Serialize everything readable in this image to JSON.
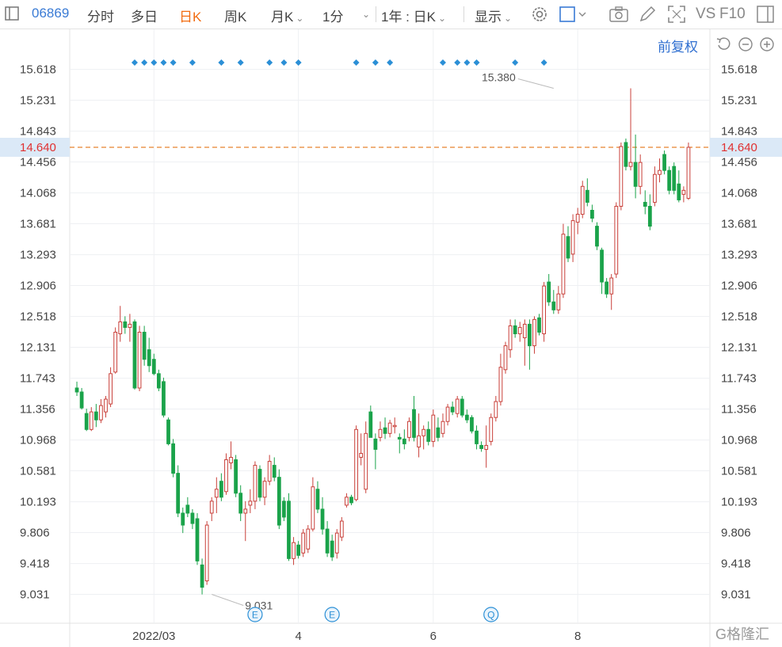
{
  "toolbar": {
    "code": "06869",
    "items": [
      "分时",
      "多日",
      "日K",
      "周K",
      "月K",
      "1分",
      "1年 : 日K",
      "显示"
    ],
    "active": "日K",
    "right_text": [
      "VS",
      "F10"
    ]
  },
  "fuquan_label": "前复权",
  "colors": {
    "up": "#c9403a",
    "down": "#1aa34a",
    "current": "#e6822e",
    "event": "#2b8fd6",
    "accent": "#f26c11",
    "link": "#2f6fd0"
  },
  "icons": [
    "settings-icon",
    "display-box-icon",
    "camera-icon",
    "pen-icon",
    "fullscreen-icon",
    "window-icon",
    "reset-icon",
    "zoom-out-icon",
    "zoom-in-icon"
  ],
  "chart_data": {
    "type": "candlestick",
    "y_ticks": [
      "15.618",
      "15.231",
      "14.843",
      "14.456",
      "14.068",
      "13.681",
      "13.293",
      "12.906",
      "12.518",
      "12.131",
      "11.743",
      "11.356",
      "10.968",
      "10.581",
      "10.193",
      "9.806",
      "9.418",
      "9.031"
    ],
    "ylim": [
      8.85,
      15.8
    ],
    "x_ticks": [
      {
        "label": "2022/03",
        "index": 16
      },
      {
        "label": "4",
        "index": 46
      },
      {
        "label": "6",
        "index": 74
      },
      {
        "label": "8",
        "index": 104
      }
    ],
    "current_price": "14.640",
    "high_label": {
      "value": "15.380",
      "index": 99
    },
    "low_label": {
      "value": "9.031",
      "index": 28
    },
    "event_markers": [
      {
        "label": "E",
        "index": 37
      },
      {
        "label": "E",
        "index": 53
      },
      {
        "label": "Q",
        "index": 86
      }
    ],
    "top_marker_indices": [
      12,
      14,
      16,
      18,
      20,
      24,
      30,
      34,
      40,
      43,
      46,
      58,
      62,
      65,
      76,
      79,
      81,
      83,
      91,
      97
    ],
    "candles": [
      {
        "o": 11.62,
        "h": 11.7,
        "l": 11.52,
        "c": 11.57
      },
      {
        "o": 11.57,
        "h": 11.62,
        "l": 11.35,
        "c": 11.37
      },
      {
        "o": 11.3,
        "h": 11.36,
        "l": 11.08,
        "c": 11.1
      },
      {
        "o": 11.1,
        "h": 11.38,
        "l": 11.08,
        "c": 11.32
      },
      {
        "o": 11.32,
        "h": 11.42,
        "l": 11.13,
        "c": 11.22
      },
      {
        "o": 11.22,
        "h": 11.48,
        "l": 11.18,
        "c": 11.4
      },
      {
        "o": 11.32,
        "h": 11.52,
        "l": 11.25,
        "c": 11.48
      },
      {
        "o": 11.42,
        "h": 11.88,
        "l": 11.38,
        "c": 11.8
      },
      {
        "o": 11.82,
        "h": 12.38,
        "l": 11.8,
        "c": 12.32
      },
      {
        "o": 12.3,
        "h": 12.65,
        "l": 12.2,
        "c": 12.45
      },
      {
        "o": 12.45,
        "h": 12.52,
        "l": 12.3,
        "c": 12.38
      },
      {
        "o": 12.38,
        "h": 12.55,
        "l": 12.2,
        "c": 12.42
      },
      {
        "o": 12.45,
        "h": 12.48,
        "l": 11.6,
        "c": 11.62
      },
      {
        "o": 11.62,
        "h": 12.4,
        "l": 11.58,
        "c": 12.32
      },
      {
        "o": 12.32,
        "h": 12.4,
        "l": 11.9,
        "c": 11.98
      },
      {
        "o": 12.1,
        "h": 12.25,
        "l": 11.82,
        "c": 11.9
      },
      {
        "o": 11.98,
        "h": 12.05,
        "l": 11.78,
        "c": 11.8
      },
      {
        "o": 11.8,
        "h": 11.85,
        "l": 11.58,
        "c": 11.62
      },
      {
        "o": 11.7,
        "h": 11.75,
        "l": 11.25,
        "c": 11.28
      },
      {
        "o": 11.22,
        "h": 11.25,
        "l": 10.9,
        "c": 10.92
      },
      {
        "o": 10.92,
        "h": 10.98,
        "l": 10.5,
        "c": 10.55
      },
      {
        "o": 10.55,
        "h": 10.65,
        "l": 10.0,
        "c": 10.05
      },
      {
        "o": 10.05,
        "h": 10.12,
        "l": 9.8,
        "c": 9.9
      },
      {
        "o": 10.15,
        "h": 10.25,
        "l": 10.0,
        "c": 10.05
      },
      {
        "o": 10.05,
        "h": 10.1,
        "l": 9.85,
        "c": 9.92
      },
      {
        "o": 9.98,
        "h": 10.05,
        "l": 9.4,
        "c": 9.45
      },
      {
        "o": 9.4,
        "h": 9.48,
        "l": 9.03,
        "c": 9.12
      },
      {
        "o": 9.2,
        "h": 9.95,
        "l": 9.15,
        "c": 9.9
      },
      {
        "o": 10.05,
        "h": 10.25,
        "l": 9.95,
        "c": 10.2
      },
      {
        "o": 10.25,
        "h": 10.5,
        "l": 10.05,
        "c": 10.35
      },
      {
        "o": 10.45,
        "h": 10.55,
        "l": 10.2,
        "c": 10.25
      },
      {
        "o": 10.32,
        "h": 10.8,
        "l": 10.28,
        "c": 10.72
      },
      {
        "o": 10.68,
        "h": 10.95,
        "l": 10.6,
        "c": 10.75
      },
      {
        "o": 10.72,
        "h": 10.78,
        "l": 10.25,
        "c": 10.3
      },
      {
        "o": 10.3,
        "h": 10.4,
        "l": 9.95,
        "c": 10.05
      },
      {
        "o": 10.05,
        "h": 10.2,
        "l": 9.7,
        "c": 10.1
      },
      {
        "o": 10.15,
        "h": 10.35,
        "l": 10.05,
        "c": 10.2
      },
      {
        "o": 10.2,
        "h": 10.7,
        "l": 10.1,
        "c": 10.65
      },
      {
        "o": 10.6,
        "h": 10.65,
        "l": 10.2,
        "c": 10.25
      },
      {
        "o": 10.25,
        "h": 10.5,
        "l": 10.15,
        "c": 10.45
      },
      {
        "o": 10.45,
        "h": 10.78,
        "l": 10.4,
        "c": 10.7
      },
      {
        "o": 10.65,
        "h": 10.75,
        "l": 10.45,
        "c": 10.5
      },
      {
        "o": 10.5,
        "h": 10.6,
        "l": 9.85,
        "c": 9.9
      },
      {
        "o": 10.2,
        "h": 10.25,
        "l": 9.95,
        "c": 10.0
      },
      {
        "o": 10.2,
        "h": 10.3,
        "l": 9.45,
        "c": 9.48
      },
      {
        "o": 9.48,
        "h": 9.75,
        "l": 9.4,
        "c": 9.68
      },
      {
        "o": 9.65,
        "h": 9.7,
        "l": 9.48,
        "c": 9.52
      },
      {
        "o": 9.55,
        "h": 9.85,
        "l": 9.5,
        "c": 9.8
      },
      {
        "o": 9.6,
        "h": 9.9,
        "l": 9.55,
        "c": 9.85
      },
      {
        "o": 9.85,
        "h": 10.5,
        "l": 9.82,
        "c": 10.38
      },
      {
        "o": 10.35,
        "h": 10.45,
        "l": 10.05,
        "c": 10.1
      },
      {
        "o": 10.1,
        "h": 10.25,
        "l": 9.78,
        "c": 9.85
      },
      {
        "o": 9.85,
        "h": 9.95,
        "l": 9.5,
        "c": 9.55
      },
      {
        "o": 9.7,
        "h": 9.78,
        "l": 9.45,
        "c": 9.5
      },
      {
        "o": 9.55,
        "h": 9.85,
        "l": 9.48,
        "c": 9.8
      },
      {
        "o": 9.75,
        "h": 10.0,
        "l": 9.7,
        "c": 9.95
      },
      {
        "o": 10.15,
        "h": 10.3,
        "l": 10.12,
        "c": 10.25
      },
      {
        "o": 10.25,
        "h": 10.28,
        "l": 10.15,
        "c": 10.18
      },
      {
        "o": 10.22,
        "h": 11.15,
        "l": 10.2,
        "c": 11.1
      },
      {
        "o": 10.75,
        "h": 11.05,
        "l": 10.65,
        "c": 10.8
      },
      {
        "o": 10.35,
        "h": 11.2,
        "l": 10.3,
        "c": 11.05
      },
      {
        "o": 11.32,
        "h": 11.4,
        "l": 11.1,
        "c": 11.0
      },
      {
        "o": 10.98,
        "h": 11.05,
        "l": 10.6,
        "c": 10.85
      },
      {
        "o": 11.0,
        "h": 11.2,
        "l": 10.95,
        "c": 11.1
      },
      {
        "o": 11.12,
        "h": 11.25,
        "l": 10.98,
        "c": 11.05
      },
      {
        "o": 11.05,
        "h": 11.22,
        "l": 11.0,
        "c": 11.18
      },
      {
        "o": 11.15,
        "h": 11.25,
        "l": 11.05,
        "c": 11.15
      },
      {
        "o": 11.0,
        "h": 11.05,
        "l": 10.8,
        "c": 10.98
      },
      {
        "o": 10.98,
        "h": 11.1,
        "l": 10.85,
        "c": 10.92
      },
      {
        "o": 11.0,
        "h": 11.25,
        "l": 10.95,
        "c": 11.2
      },
      {
        "o": 11.35,
        "h": 11.52,
        "l": 10.95,
        "c": 11.0
      },
      {
        "o": 10.88,
        "h": 11.3,
        "l": 10.75,
        "c": 11.02
      },
      {
        "o": 11.02,
        "h": 11.15,
        "l": 10.85,
        "c": 11.1
      },
      {
        "o": 11.1,
        "h": 11.2,
        "l": 10.9,
        "c": 10.95
      },
      {
        "o": 10.95,
        "h": 11.35,
        "l": 10.88,
        "c": 11.28
      },
      {
        "o": 11.12,
        "h": 11.25,
        "l": 10.95,
        "c": 11.0
      },
      {
        "o": 11.05,
        "h": 11.3,
        "l": 11.0,
        "c": 11.2
      },
      {
        "o": 11.2,
        "h": 11.42,
        "l": 11.15,
        "c": 11.38
      },
      {
        "o": 11.38,
        "h": 11.45,
        "l": 11.28,
        "c": 11.32
      },
      {
        "o": 11.3,
        "h": 11.52,
        "l": 11.25,
        "c": 11.48
      },
      {
        "o": 11.48,
        "h": 11.52,
        "l": 11.25,
        "c": 11.28
      },
      {
        "o": 11.28,
        "h": 11.35,
        "l": 11.18,
        "c": 11.22
      },
      {
        "o": 11.25,
        "h": 11.28,
        "l": 11.05,
        "c": 11.08
      },
      {
        "o": 11.08,
        "h": 11.15,
        "l": 10.85,
        "c": 10.92
      },
      {
        "o": 10.9,
        "h": 10.95,
        "l": 10.82,
        "c": 10.86
      },
      {
        "o": 10.85,
        "h": 11.15,
        "l": 10.62,
        "c": 10.9
      },
      {
        "o": 10.95,
        "h": 11.3,
        "l": 10.9,
        "c": 11.25
      },
      {
        "o": 11.25,
        "h": 11.52,
        "l": 11.2,
        "c": 11.45
      },
      {
        "o": 11.45,
        "h": 12.05,
        "l": 11.4,
        "c": 11.88
      },
      {
        "o": 11.85,
        "h": 12.2,
        "l": 11.8,
        "c": 12.15
      },
      {
        "o": 12.1,
        "h": 12.48,
        "l": 12.0,
        "c": 12.4
      },
      {
        "o": 12.4,
        "h": 12.48,
        "l": 12.25,
        "c": 12.3
      },
      {
        "o": 12.3,
        "h": 12.45,
        "l": 12.2,
        "c": 12.38
      },
      {
        "o": 12.25,
        "h": 12.48,
        "l": 11.9,
        "c": 12.42
      },
      {
        "o": 12.42,
        "h": 12.48,
        "l": 11.85,
        "c": 12.15
      },
      {
        "o": 12.15,
        "h": 12.52,
        "l": 12.05,
        "c": 12.48
      },
      {
        "o": 12.5,
        "h": 12.55,
        "l": 12.28,
        "c": 12.32
      },
      {
        "o": 12.3,
        "h": 12.95,
        "l": 12.2,
        "c": 12.9
      },
      {
        "o": 12.95,
        "h": 13.05,
        "l": 12.65,
        "c": 12.7
      },
      {
        "o": 12.7,
        "h": 12.85,
        "l": 12.55,
        "c": 12.6
      }
    ],
    "candles_b": [
      {
        "o": 12.6,
        "h": 12.9,
        "l": 12.55,
        "c": 12.8
      },
      {
        "o": 12.8,
        "h": 13.68,
        "l": 12.75,
        "c": 13.55
      },
      {
        "o": 13.52,
        "h": 13.65,
        "l": 13.2,
        "c": 13.25
      },
      {
        "o": 13.3,
        "h": 13.8,
        "l": 13.2,
        "c": 13.72
      },
      {
        "o": 13.7,
        "h": 13.88,
        "l": 13.55,
        "c": 13.8
      },
      {
        "o": 13.8,
        "h": 14.22,
        "l": 13.75,
        "c": 14.15
      },
      {
        "o": 14.1,
        "h": 14.25,
        "l": 13.9,
        "c": 13.95
      },
      {
        "o": 13.85,
        "h": 13.92,
        "l": 13.7,
        "c": 13.75
      },
      {
        "o": 13.65,
        "h": 13.7,
        "l": 13.35,
        "c": 13.4
      },
      {
        "o": 13.35,
        "h": 13.38,
        "l": 12.8,
        "c": 12.95
      },
      {
        "o": 12.95,
        "h": 13.0,
        "l": 12.75,
        "c": 12.8
      },
      {
        "o": 12.8,
        "h": 13.05,
        "l": 12.6,
        "c": 13.0
      },
      {
        "o": 13.05,
        "h": 13.95,
        "l": 13.0,
        "c": 13.9
      },
      {
        "o": 13.9,
        "h": 14.7,
        "l": 13.85,
        "c": 14.65
      },
      {
        "o": 14.7,
        "h": 14.75,
        "l": 14.35,
        "c": 14.4
      },
      {
        "o": 14.4,
        "h": 15.38,
        "l": 14.35,
        "c": 14.45
      },
      {
        "o": 14.45,
        "h": 14.8,
        "l": 14.0,
        "c": 14.15
      },
      {
        "o": 14.15,
        "h": 14.55,
        "l": 14.05,
        "c": 14.45
      },
      {
        "o": 13.95,
        "h": 14.1,
        "l": 13.8,
        "c": 13.9
      },
      {
        "o": 13.9,
        "h": 14.05,
        "l": 13.6,
        "c": 13.65
      },
      {
        "o": 13.95,
        "h": 14.4,
        "l": 13.9,
        "c": 14.3
      },
      {
        "o": 14.3,
        "h": 14.5,
        "l": 14.2,
        "c": 14.35
      },
      {
        "o": 14.55,
        "h": 14.6,
        "l": 14.3,
        "c": 14.35
      },
      {
        "o": 14.35,
        "h": 14.4,
        "l": 14.05,
        "c": 14.1
      },
      {
        "o": 14.4,
        "h": 14.45,
        "l": 14.05,
        "c": 14.1
      },
      {
        "o": 14.18,
        "h": 14.35,
        "l": 13.95,
        "c": 13.98
      },
      {
        "o": 14.05,
        "h": 14.15,
        "l": 13.95,
        "c": 14.1
      },
      {
        "o": 14.0,
        "h": 14.7,
        "l": 13.98,
        "c": 14.64
      }
    ]
  }
}
